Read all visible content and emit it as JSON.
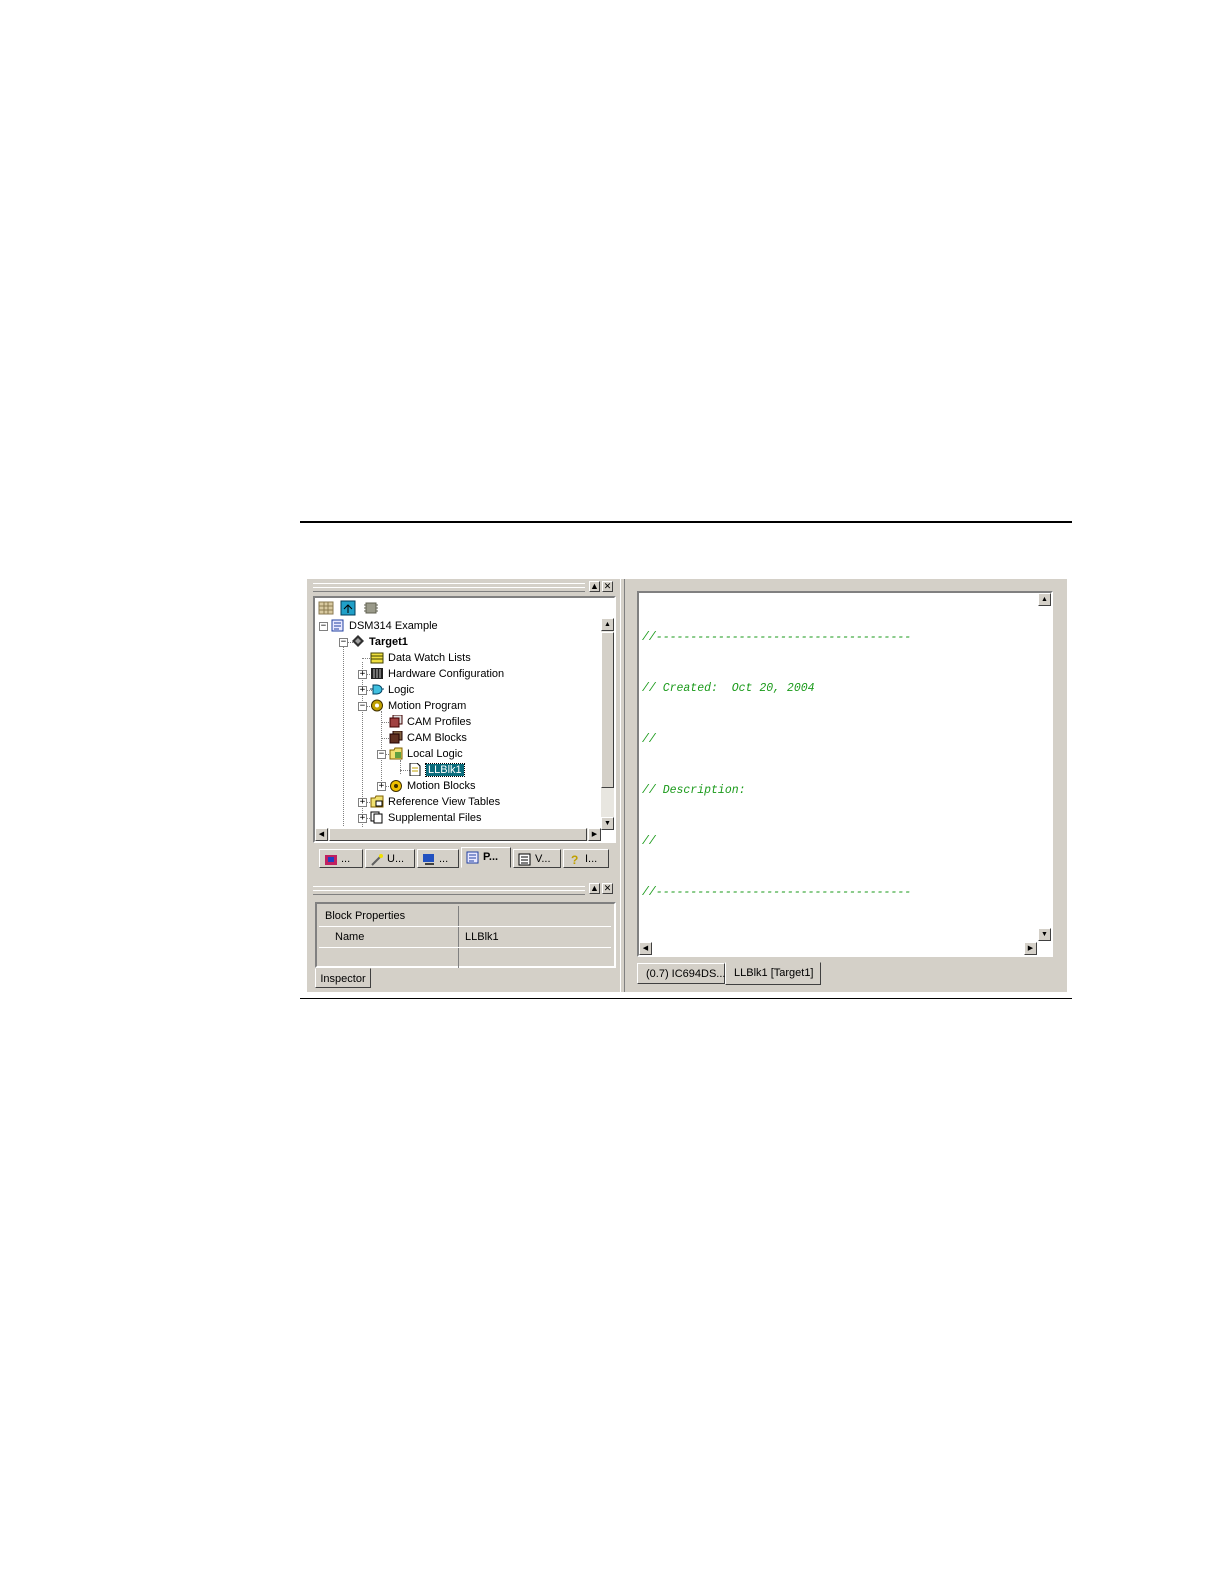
{
  "tree": {
    "toolbar_icons": [
      "grid-icon",
      "refresh-icon",
      "chip-icon"
    ],
    "nodes": [
      {
        "label": "DSM314 Example",
        "icon": "project-icon",
        "expander": "-",
        "bold": false
      },
      {
        "label": "Target1",
        "icon": "target-icon",
        "expander": "-",
        "bold": true
      },
      {
        "label": "Data Watch Lists",
        "icon": "watch-list-icon",
        "expander": "",
        "bold": false
      },
      {
        "label": "Hardware Configuration",
        "icon": "hardware-icon",
        "expander": "+",
        "bold": false
      },
      {
        "label": "Logic",
        "icon": "logic-icon",
        "expander": "+",
        "bold": false
      },
      {
        "label": "Motion Program",
        "icon": "motion-program-icon",
        "expander": "-",
        "bold": false
      },
      {
        "label": "CAM Profiles",
        "icon": "cam-profiles-icon",
        "expander": "",
        "bold": false
      },
      {
        "label": "CAM Blocks",
        "icon": "cam-blocks-icon",
        "expander": "",
        "bold": false
      },
      {
        "label": "Local Logic",
        "icon": "folder-icon",
        "expander": "-",
        "bold": false
      },
      {
        "label": "LLBlk1",
        "icon": "document-icon",
        "expander": "",
        "bold": false,
        "selected": true
      },
      {
        "label": "Motion Blocks",
        "icon": "motion-blocks-icon",
        "expander": "+",
        "bold": false
      },
      {
        "label": "Reference View Tables",
        "icon": "folder-table-icon",
        "expander": "+",
        "bold": false
      },
      {
        "label": "Supplemental Files",
        "icon": "files-icon",
        "expander": "+",
        "bold": false
      }
    ]
  },
  "navigator_tabs": [
    {
      "label": "...",
      "icon": "toolchest-icon"
    },
    {
      "label": "U...",
      "icon": "wand-icon"
    },
    {
      "label": "...",
      "icon": "companion-icon"
    },
    {
      "label": "P...",
      "icon": "project-icon",
      "active": true
    },
    {
      "label": "V...",
      "icon": "variables-icon"
    },
    {
      "label": "I...",
      "icon": "help-icon"
    }
  ],
  "inspector": {
    "rows": [
      {
        "key": "Block Properties",
        "value": ""
      },
      {
        "key": "Name",
        "value": "LLBlk1"
      },
      {
        "key": "",
        "value": ""
      }
    ],
    "tab": "Inspector"
  },
  "editor": {
    "lines": [
      "//-------------------------------------",
      "// Created:  Oct 20, 2004",
      "//",
      "// Description:",
      "//",
      "//-------------------------------------"
    ],
    "tabs": [
      "(0.7) IC694DS...",
      "LLBlk1 [Target1]"
    ],
    "active_tab": 1,
    "colors": {
      "comment": "#1a9a1a"
    }
  }
}
